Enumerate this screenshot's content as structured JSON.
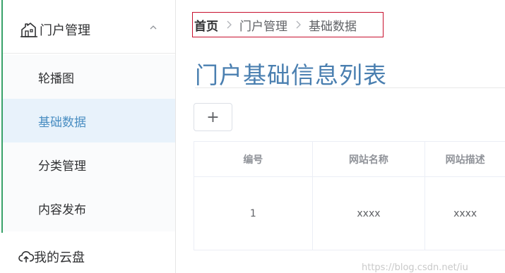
{
  "sidebar": {
    "portal_menu": {
      "label": "门户管理",
      "icon": "building-icon",
      "chevron": "chevron-up-icon"
    },
    "items": [
      {
        "label": "轮播图",
        "active": false
      },
      {
        "label": "基础数据",
        "active": true
      },
      {
        "label": "分类管理",
        "active": false
      },
      {
        "label": "内容发布",
        "active": false
      }
    ],
    "cloud_menu": {
      "label": "我的云盘",
      "icon": "cloud-upload-icon"
    }
  },
  "breadcrumb": {
    "items": [
      "首页",
      "门户管理",
      "基础数据"
    ],
    "separator_icon": "chevron-right-icon"
  },
  "page": {
    "title": "门户基础信息列表"
  },
  "toolbar": {
    "add_label": "+"
  },
  "table": {
    "columns": [
      "编号",
      "网站名称",
      "网站描述"
    ],
    "rows": [
      [
        "1",
        "xxxx",
        "xxxx"
      ]
    ]
  },
  "watermark": "https://blog.csdn.net/iu",
  "colors": {
    "accent": "#4a7fb0",
    "active_bg": "#e8f2fb",
    "sidebar_line": "#38a169",
    "highlight_border": "#c8102e"
  }
}
